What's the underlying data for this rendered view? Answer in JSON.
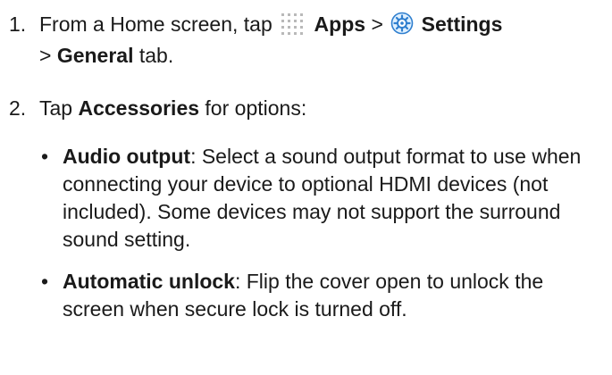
{
  "steps": [
    {
      "number": "1.",
      "t1": "From a Home screen, tap",
      "apps_label": "Apps",
      "sep1": ">",
      "settings_label": "Settings",
      "sep2": ">",
      "general_label": "General",
      "t2": "tab."
    },
    {
      "number": "2.",
      "t1": "Tap",
      "accessories_label": "Accessories",
      "t2": "for options:"
    }
  ],
  "bullets": [
    {
      "marker": "•",
      "term": "Audio output",
      "desc": ": Select a sound output format to use when connecting your device to optional HDMI devices (not included). Some devices may not support the surround sound setting."
    },
    {
      "marker": "•",
      "term": "Automatic unlock",
      "desc": ": Flip the cover open to unlock the screen when secure lock is turned off."
    }
  ],
  "icons": {
    "apps": "apps-grid-icon",
    "settings": "settings-gear-icon",
    "accent": "#2f7fcf"
  }
}
